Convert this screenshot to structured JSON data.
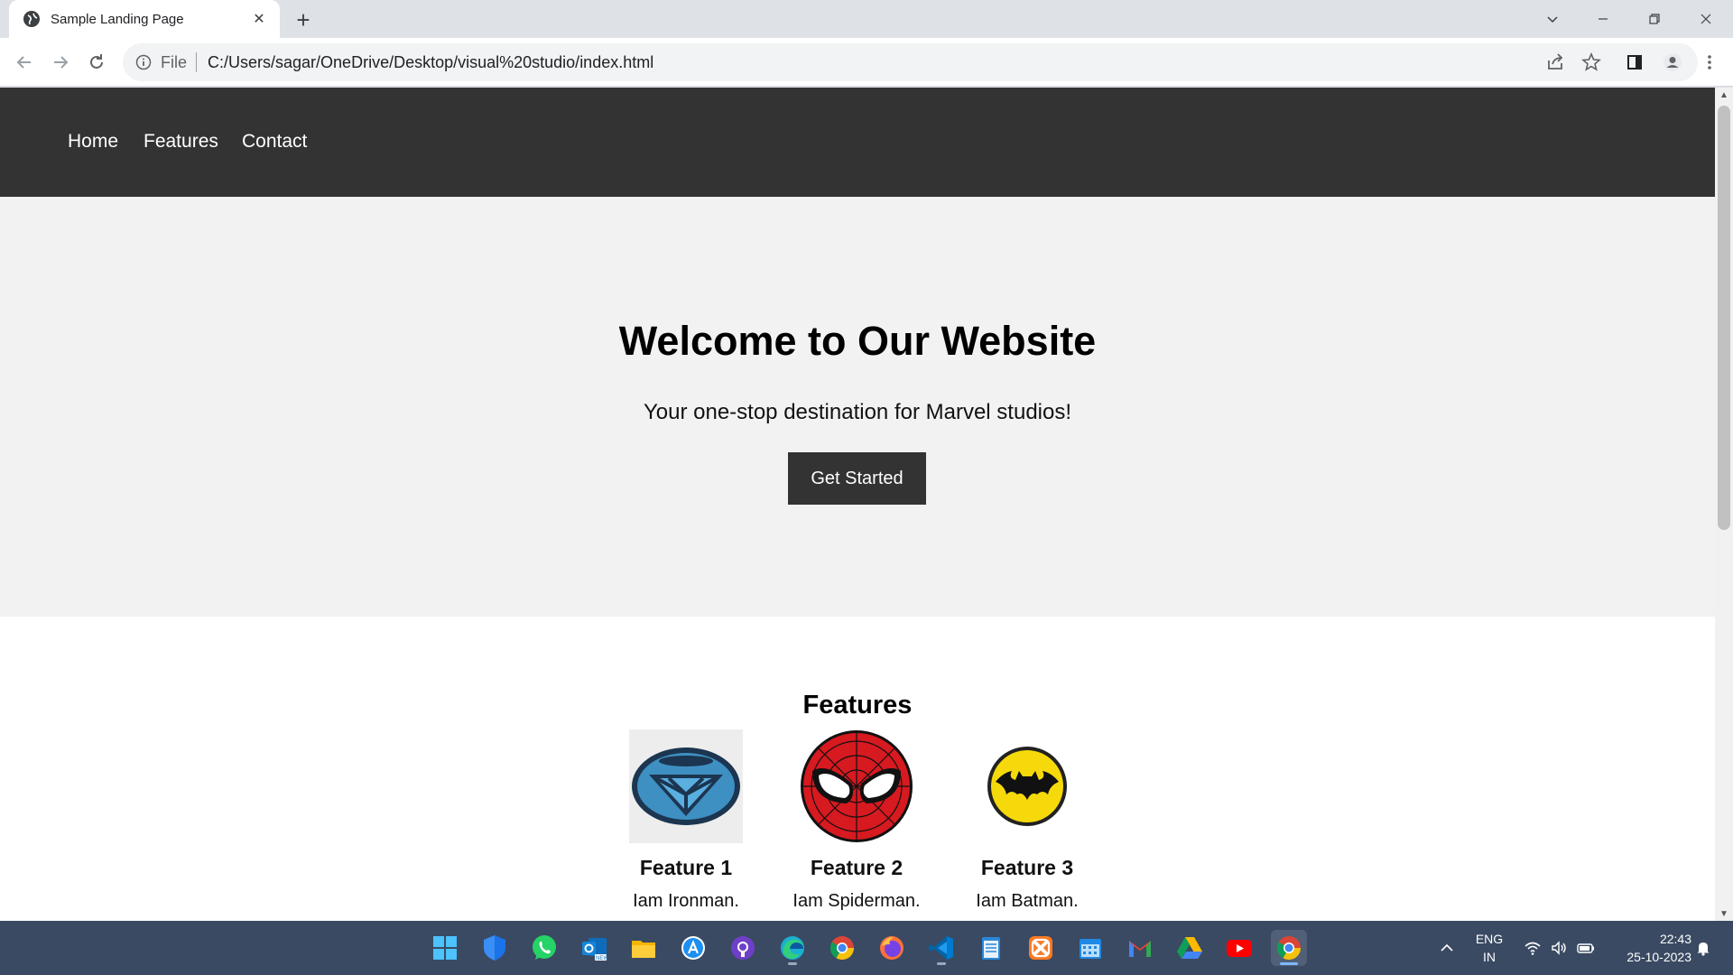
{
  "browser": {
    "tab_title": "Sample Landing Page",
    "scheme_label": "File",
    "url": "C:/Users/sagar/OneDrive/Desktop/visual%20studio/index.html"
  },
  "page": {
    "nav": [
      "Home",
      "Features",
      "Contact"
    ],
    "hero": {
      "title": "Welcome to Our Website",
      "subtitle": "Your one-stop destination for Marvel studios!",
      "cta": "Get Started"
    },
    "features_heading": "Features",
    "features": [
      {
        "title": "Feature 1",
        "desc": "Iam Ironman.",
        "icon": "arc-reactor-icon"
      },
      {
        "title": "Feature 2",
        "desc": "Iam Spiderman.",
        "icon": "spiderman-mask-icon"
      },
      {
        "title": "Feature 3",
        "desc": "Iam Batman.",
        "icon": "batman-logo-icon"
      }
    ]
  },
  "taskbar": {
    "apps": [
      "start-icon",
      "defender-icon",
      "whatsapp-icon",
      "outlook-icon",
      "file-explorer-icon",
      "app-store-icon",
      "github-icon",
      "edge-icon",
      "chrome-icon",
      "firefox-icon",
      "vscode-icon",
      "notepad-icon",
      "xampp-icon",
      "calendar-icon",
      "gmail-icon",
      "google-drive-icon",
      "youtube-icon",
      "chrome-active-icon"
    ],
    "lang_line1": "ENG",
    "lang_line2": "IN",
    "time": "22:43",
    "date": "25-10-2023"
  },
  "colors": {
    "nav_bg": "#333333",
    "hero_bg": "#f2f2f2",
    "taskbar_bg": "#3a4a63"
  }
}
